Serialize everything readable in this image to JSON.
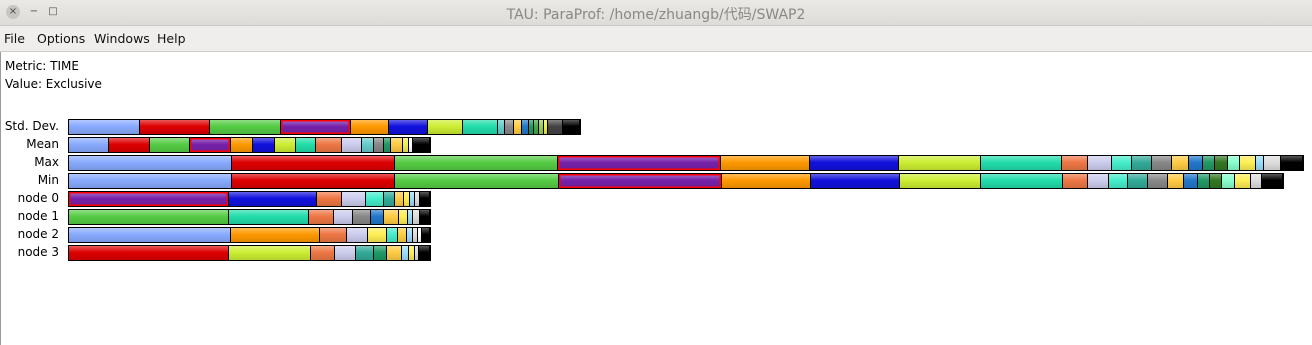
{
  "window": {
    "title": "TAU: ParaProf: /home/zhuangb/代码/SWAP2",
    "close_icon": "×",
    "minimize_icon": "−",
    "maximize_icon": "□"
  },
  "menu": [
    "File",
    "Options",
    "Windows",
    "Help"
  ],
  "info": {
    "metric": "Metric: TIME",
    "value": "Value: Exclusive"
  },
  "rows": [
    {
      "label": "Std. Dev.",
      "total_fraction": 0.4138,
      "segments": [
        {
          "color": "#88aaff",
          "fraction": 0.138
        },
        {
          "color": "#dd0000",
          "fraction": 0.138
        },
        {
          "color": "#55cc44",
          "fraction": 0.138
        },
        {
          "color": "#7722aa",
          "fraction": 0.138,
          "selected": true
        },
        {
          "color": "#ff9900",
          "fraction": 0.075
        },
        {
          "color": "#1111dd",
          "fraction": 0.075
        },
        {
          "color": "#ccee33",
          "fraction": 0.069
        },
        {
          "color": "#22ddaa",
          "fraction": 0.069
        },
        {
          "color": "#66cccc",
          "fraction": 0.014
        },
        {
          "color": "#888888",
          "fraction": 0.016
        },
        {
          "color": "#ffcc44",
          "fraction": 0.016
        },
        {
          "color": "#2277cc",
          "fraction": 0.014
        },
        {
          "color": "#229966",
          "fraction": 0.01
        },
        {
          "color": "#44aa44",
          "fraction": 0.01
        },
        {
          "color": "#9acc55",
          "fraction": 0.01
        },
        {
          "color": "#eeee55",
          "fraction": 0.008
        },
        {
          "color": "#444444",
          "fraction": 0.029
        },
        {
          "color": "#000000",
          "fraction": 0.033
        }
      ]
    },
    {
      "label": "Mean",
      "total_fraction": 0.2925,
      "segments": [
        {
          "color": "#88aaff",
          "fraction": 0.111
        },
        {
          "color": "#dd0000",
          "fraction": 0.111
        },
        {
          "color": "#55cc44",
          "fraction": 0.111
        },
        {
          "color": "#7722aa",
          "fraction": 0.111,
          "selected": true
        },
        {
          "color": "#ff9900",
          "fraction": 0.061
        },
        {
          "color": "#1111dd",
          "fraction": 0.061
        },
        {
          "color": "#ccee33",
          "fraction": 0.056
        },
        {
          "color": "#22ddaa",
          "fraction": 0.056
        },
        {
          "color": "#ee7744",
          "fraction": 0.071
        },
        {
          "color": "#ccccee",
          "fraction": 0.056
        },
        {
          "color": "#66cccc",
          "fraction": 0.033
        },
        {
          "color": "#888888",
          "fraction": 0.028
        },
        {
          "color": "#229966",
          "fraction": 0.019
        },
        {
          "color": "#ffcc44",
          "fraction": 0.033
        },
        {
          "color": "#eeee55",
          "fraction": 0.017
        },
        {
          "color": "#ffffff",
          "fraction": 0.011
        },
        {
          "color": "#000000",
          "fraction": 0.045
        }
      ]
    },
    {
      "label": "Max",
      "total_fraction": 1.0,
      "segments": [
        {
          "color": "#88aaff",
          "fraction": 0.13
        },
        {
          "color": "#dd0000",
          "fraction": 0.13
        },
        {
          "color": "#55cc44",
          "fraction": 0.13
        },
        {
          "color": "#7722aa",
          "fraction": 0.13,
          "selected": true
        },
        {
          "color": "#ff9900",
          "fraction": 0.071
        },
        {
          "color": "#1111dd",
          "fraction": 0.071
        },
        {
          "color": "#ccee33",
          "fraction": 0.065
        },
        {
          "color": "#22ddaa",
          "fraction": 0.065
        },
        {
          "color": "#ee7744",
          "fraction": 0.021
        },
        {
          "color": "#ccccee",
          "fraction": 0.019
        },
        {
          "color": "#44eecc",
          "fraction": 0.016
        },
        {
          "color": "#33aa99",
          "fraction": 0.016
        },
        {
          "color": "#888888",
          "fraction": 0.016
        },
        {
          "color": "#ffcc44",
          "fraction": 0.013
        },
        {
          "color": "#2277cc",
          "fraction": 0.011
        },
        {
          "color": "#229966",
          "fraction": 0.01
        },
        {
          "color": "#337722",
          "fraction": 0.01
        },
        {
          "color": "#88ffcc",
          "fraction": 0.01
        },
        {
          "color": "#ffee55",
          "fraction": 0.013
        },
        {
          "color": "#99ddff",
          "fraction": 0.006
        },
        {
          "color": "#dddddd",
          "fraction": 0.014
        },
        {
          "color": "#000000",
          "fraction": 0.017
        }
      ]
    },
    {
      "label": "Min",
      "total_fraction": 0.9838,
      "segments": [
        {
          "color": "#88aaff",
          "fraction": 0.132
        },
        {
          "color": "#dd0000",
          "fraction": 0.132
        },
        {
          "color": "#55cc44",
          "fraction": 0.132
        },
        {
          "color": "#7722aa",
          "fraction": 0.132,
          "selected": true
        },
        {
          "color": "#ff9900",
          "fraction": 0.072
        },
        {
          "color": "#1111dd",
          "fraction": 0.072
        },
        {
          "color": "#ccee33",
          "fraction": 0.066
        },
        {
          "color": "#22ddaa",
          "fraction": 0.066
        },
        {
          "color": "#ee7744",
          "fraction": 0.02
        },
        {
          "color": "#ccccee",
          "fraction": 0.017
        },
        {
          "color": "#44eecc",
          "fraction": 0.016
        },
        {
          "color": "#33aa99",
          "fraction": 0.016
        },
        {
          "color": "#888888",
          "fraction": 0.016
        },
        {
          "color": "#ffcc44",
          "fraction": 0.013
        },
        {
          "color": "#2277cc",
          "fraction": 0.011
        },
        {
          "color": "#229966",
          "fraction": 0.01
        },
        {
          "color": "#337722",
          "fraction": 0.01
        },
        {
          "color": "#88ffcc",
          "fraction": 0.01
        },
        {
          "color": "#ffee55",
          "fraction": 0.013
        },
        {
          "color": "#dddddd",
          "fraction": 0.009
        },
        {
          "color": "#000000",
          "fraction": 0.017
        }
      ]
    },
    {
      "label": "node 0",
      "total_fraction": 0.2925,
      "segments": [
        {
          "color": "#7722aa",
          "fraction": 0.444,
          "selected": true
        },
        {
          "color": "#1111dd",
          "fraction": 0.244
        },
        {
          "color": "#ee7744",
          "fraction": 0.067
        },
        {
          "color": "#ccccee",
          "fraction": 0.067
        },
        {
          "color": "#44eecc",
          "fraction": 0.05
        },
        {
          "color": "#33aa99",
          "fraction": 0.03
        },
        {
          "color": "#ffcc44",
          "fraction": 0.025
        },
        {
          "color": "#ffee55",
          "fraction": 0.017
        },
        {
          "color": "#99ddff",
          "fraction": 0.014
        },
        {
          "color": "#dddddd",
          "fraction": 0.014
        },
        {
          "color": "#000000",
          "fraction": 0.028
        }
      ]
    },
    {
      "label": "node 1",
      "total_fraction": 0.2925,
      "segments": [
        {
          "color": "#55cc44",
          "fraction": 0.444
        },
        {
          "color": "#22ddaa",
          "fraction": 0.222
        },
        {
          "color": "#ee7744",
          "fraction": 0.067
        },
        {
          "color": "#ccccee",
          "fraction": 0.053
        },
        {
          "color": "#888888",
          "fraction": 0.05
        },
        {
          "color": "#2277cc",
          "fraction": 0.036
        },
        {
          "color": "#ffcc44",
          "fraction": 0.042
        },
        {
          "color": "#ffee55",
          "fraction": 0.025
        },
        {
          "color": "#99ddff",
          "fraction": 0.014
        },
        {
          "color": "#dddddd",
          "fraction": 0.019
        },
        {
          "color": "#000000",
          "fraction": 0.028
        }
      ]
    },
    {
      "label": "node 2",
      "total_fraction": 0.2925,
      "segments": [
        {
          "color": "#88aaff",
          "fraction": 0.444
        },
        {
          "color": "#ff9900",
          "fraction": 0.244
        },
        {
          "color": "#ee7744",
          "fraction": 0.075
        },
        {
          "color": "#ccccee",
          "fraction": 0.058
        },
        {
          "color": "#ffee55",
          "fraction": 0.05
        },
        {
          "color": "#44eecc",
          "fraction": 0.03
        },
        {
          "color": "#ffcc44",
          "fraction": 0.025
        },
        {
          "color": "#99ddff",
          "fraction": 0.017
        },
        {
          "color": "#dddddd",
          "fraction": 0.014
        },
        {
          "color": "#ffffff",
          "fraction": 0.011
        },
        {
          "color": "#000000",
          "fraction": 0.022
        }
      ]
    },
    {
      "label": "node 3",
      "total_fraction": 0.2925,
      "segments": [
        {
          "color": "#dd0000",
          "fraction": 0.444
        },
        {
          "color": "#ccee33",
          "fraction": 0.225
        },
        {
          "color": "#ee7744",
          "fraction": 0.067
        },
        {
          "color": "#ccccee",
          "fraction": 0.058
        },
        {
          "color": "#33aa99",
          "fraction": 0.05
        },
        {
          "color": "#229966",
          "fraction": 0.036
        },
        {
          "color": "#ffcc44",
          "fraction": 0.042
        },
        {
          "color": "#99ddff",
          "fraction": 0.02
        },
        {
          "color": "#ffee55",
          "fraction": 0.017
        },
        {
          "color": "#dddddd",
          "fraction": 0.011
        },
        {
          "color": "#000000",
          "fraction": 0.03
        }
      ]
    }
  ]
}
